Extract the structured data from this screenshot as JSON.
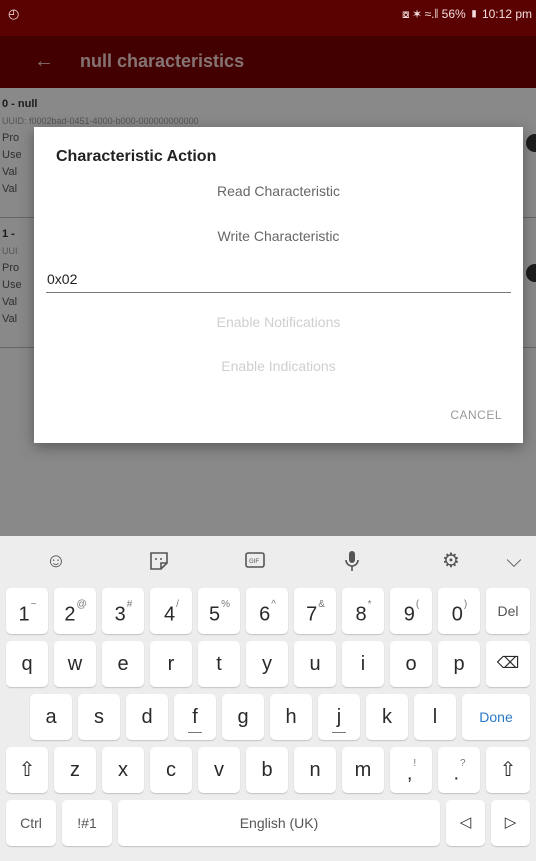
{
  "status_bar": {
    "left_icon": "camera-icon",
    "right_text": "⧇ ✶ ≈.∥ 56% ▮ 10:12 pm"
  },
  "app_bar": {
    "back_icon": "back-arrow-icon",
    "title": "null characteristics"
  },
  "list": {
    "items": [
      {
        "name": "0 - null",
        "uuid": "UUID: f0002bad-0451-4000-b000-000000000000",
        "lines": [
          "Pro",
          "Use",
          "Val",
          "Val"
        ]
      },
      {
        "name": "1 -",
        "uuid": "UUI",
        "lines": [
          "Pro",
          "Use",
          "Val",
          "Val"
        ]
      }
    ]
  },
  "dialog": {
    "title": "Characteristic Action",
    "read_label": "Read Characteristic",
    "write_label": "Write Characteristic",
    "input_value": "0x02",
    "enable_notifications_label": "Enable Notifications",
    "enable_indications_label": "Enable Indications",
    "cancel_label": "CANCEL"
  },
  "keyboard": {
    "toolbar": [
      "smiley-icon",
      "sticker-icon",
      "gif-icon",
      "microphone-icon",
      "settings-icon",
      "chevron-down-icon"
    ],
    "row_numbers": [
      {
        "k": "1",
        "s": "~"
      },
      {
        "k": "2",
        "s": "@"
      },
      {
        "k": "3",
        "s": "#"
      },
      {
        "k": "4",
        "s": "/"
      },
      {
        "k": "5",
        "s": "%"
      },
      {
        "k": "6",
        "s": "^"
      },
      {
        "k": "7",
        "s": "&"
      },
      {
        "k": "8",
        "s": "*"
      },
      {
        "k": "9",
        "s": "("
      },
      {
        "k": "0",
        "s": ")"
      }
    ],
    "del_label": "Del",
    "row_q": [
      "q",
      "w",
      "e",
      "r",
      "t",
      "y",
      "u",
      "i",
      "o",
      "p"
    ],
    "row_a": [
      "a",
      "s",
      "d",
      "f",
      "g",
      "h",
      "j",
      "k",
      "l"
    ],
    "done_label": "Done",
    "row_z": [
      "z",
      "x",
      "c",
      "v",
      "b",
      "n",
      "m"
    ],
    "comma": {
      "k": ",",
      "s": "!"
    },
    "period": {
      "k": ".",
      "s": "?"
    },
    "ctrl_label": "Ctrl",
    "symbols_label": "!#1",
    "space_label": "English (UK)"
  }
}
